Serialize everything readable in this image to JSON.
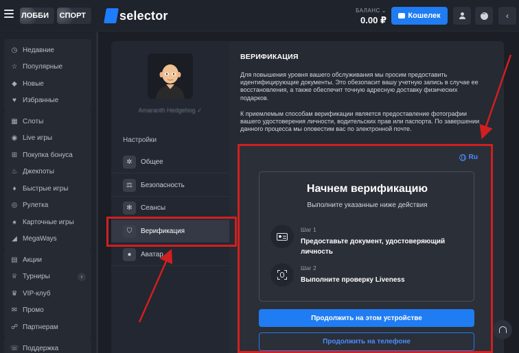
{
  "header": {
    "menu_icon": "hamburger-icon",
    "lobby_label": "ЛОББИ",
    "sport_label": "СПОРТ",
    "logo_text": "selector",
    "balance_label": "БАЛАНС",
    "balance_value": "0.00 ₽",
    "wallet_label": "Кошелек",
    "icons": [
      "user-icon",
      "chat-icon",
      "chevron-left-icon"
    ]
  },
  "sidebar": {
    "group1": [
      {
        "label": "Недавние",
        "icon": "clock-icon",
        "glyph": "◷"
      },
      {
        "label": "Популярные",
        "icon": "star-icon",
        "glyph": "☆"
      },
      {
        "label": "Новые",
        "icon": "diamond-icon",
        "glyph": "◆"
      },
      {
        "label": "Избранные",
        "icon": "heart-icon",
        "glyph": "♥"
      }
    ],
    "group2": [
      {
        "label": "Слоты",
        "icon": "slots-icon",
        "glyph": "▦"
      },
      {
        "label": "Live игры",
        "icon": "live-icon",
        "glyph": "◉"
      },
      {
        "label": "Покупка бонуса",
        "icon": "cart-icon",
        "glyph": "⊞"
      },
      {
        "label": "Джекпоты",
        "icon": "flame-icon",
        "glyph": "♨"
      },
      {
        "label": "Быстрые игры",
        "icon": "fire-icon",
        "glyph": "♦"
      },
      {
        "label": "Рулетка",
        "icon": "roulette-icon",
        "glyph": "◎"
      },
      {
        "label": "Карточные игры",
        "icon": "cards-icon",
        "glyph": "♠"
      },
      {
        "label": "MegaWays",
        "icon": "megaways-icon",
        "glyph": "◢"
      }
    ],
    "group3": [
      {
        "label": "Акции",
        "icon": "gift-icon",
        "glyph": "▤"
      },
      {
        "label": "Турниры",
        "icon": "trophy-icon",
        "glyph": "♕"
      },
      {
        "label": "VIP-клуб",
        "icon": "crown-icon",
        "glyph": "♛"
      },
      {
        "label": "Промо",
        "icon": "promo-icon",
        "glyph": "✉"
      },
      {
        "label": "Партнерам",
        "icon": "partners-icon",
        "glyph": "☍"
      }
    ],
    "group4": [
      {
        "label": "Поддержка",
        "icon": "support-icon",
        "glyph": "☏"
      }
    ]
  },
  "profile": {
    "name": "Amaranth Hedgehog ✓"
  },
  "settings": {
    "title": "Настройки",
    "menu": [
      {
        "label": "Общее",
        "icon": "gear-icon",
        "glyph": "✲"
      },
      {
        "label": "Безопасность",
        "icon": "scales-icon",
        "glyph": "⚖"
      },
      {
        "label": "Сеансы",
        "icon": "sessions-icon",
        "glyph": "✻"
      },
      {
        "label": "Верификация",
        "icon": "shield-icon",
        "glyph": "⛉"
      },
      {
        "label": "Аватар",
        "icon": "user-icon",
        "glyph": "●"
      }
    ]
  },
  "verification": {
    "title": "ВЕРИФИКАЦИЯ",
    "paragraph1": "Для повышения уровня вашего обслуживания мы просим предоставить идентифицирующие документы. Это обезопасит вашу учетную запись в случае ее восстановления, а также обеспечит точную адресную доставку физических подарков.",
    "paragraph2": "К приемлемым способам верификации является предоставление фотографии вашего удостоверения личности, водительских прав или паспорта. По завершении данного процесса мы оповестим вас по электронной почте.",
    "lang_label": "Ru",
    "inner_title": "Начнем верификацию",
    "inner_subtitle": "Выполните указанные ниже действия",
    "step1_label": "Шаг 1",
    "step1_text": "Предоставьте документ, удостоверяющий личность",
    "step2_label": "Шаг 2",
    "step2_text": "Выполните проверку Liveness",
    "continue_device": "Продолжить на этом устройстве",
    "continue_phone": "Продолжить на телефоне"
  },
  "colors": {
    "accent": "#1f7cf2",
    "highlight": "#d21f1f",
    "background": "#1b1e25"
  }
}
